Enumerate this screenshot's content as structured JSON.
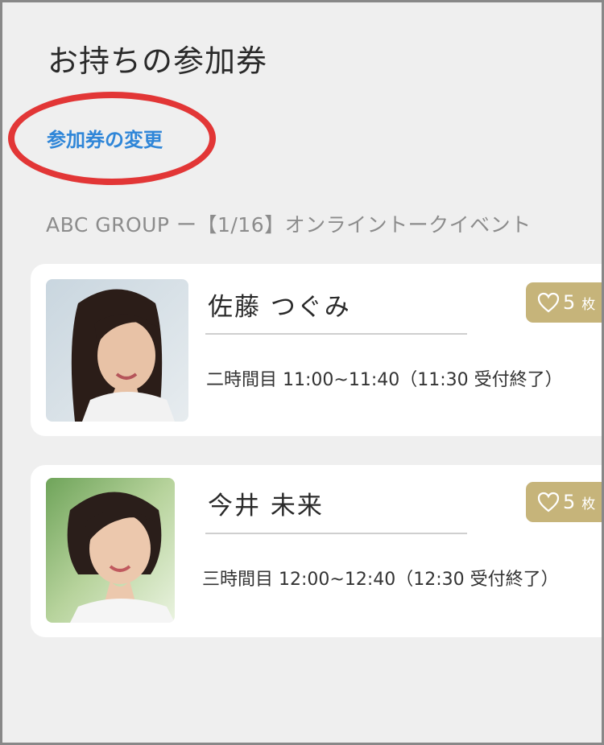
{
  "page": {
    "title": "お持ちの参加券",
    "change_link": "参加券の変更"
  },
  "event": {
    "name": "ABC GROUP ー【1/16】オンライントークイベント"
  },
  "tickets": [
    {
      "name": "佐藤 つぐみ",
      "slot": "二時間目 11:00~11:40（11:30 受付終了）",
      "count": "5",
      "unit": "枚"
    },
    {
      "name": "今井 未来",
      "slot": "三時間目 12:00~12:40（12:30 受付終了）",
      "count": "5",
      "unit": "枚"
    }
  ],
  "colors": {
    "background": "#efefef",
    "link": "#2f86d8",
    "highlight": "#e23636",
    "badge": "#c6b47a",
    "card": "#ffffff"
  },
  "icons": {
    "badge": "heart-outline-icon"
  }
}
